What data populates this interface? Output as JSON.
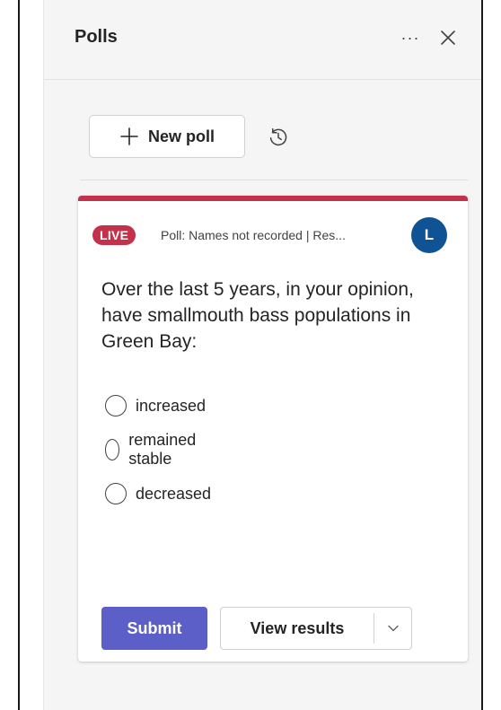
{
  "panel": {
    "title": "Polls",
    "more_icon": "ellipsis-icon",
    "close_icon": "close-icon"
  },
  "toolbar": {
    "new_poll_label": "New poll",
    "new_poll_icon": "plus-icon",
    "history_icon": "history-icon"
  },
  "poll": {
    "badge": "LIVE",
    "meta": "Poll: Names not recorded | Res...",
    "avatar_initial": "L",
    "question": "Over the last 5 years, in your opinion, have smallmouth bass populations in Green Bay:",
    "options": [
      {
        "label": "increased"
      },
      {
        "label": "remained stable"
      },
      {
        "label": "decreased"
      }
    ],
    "submit_label": "Submit",
    "view_results_label": "View results"
  },
  "colors": {
    "accent": "#5b5fc7",
    "live": "#c4314b",
    "avatar": "#0f5394"
  }
}
